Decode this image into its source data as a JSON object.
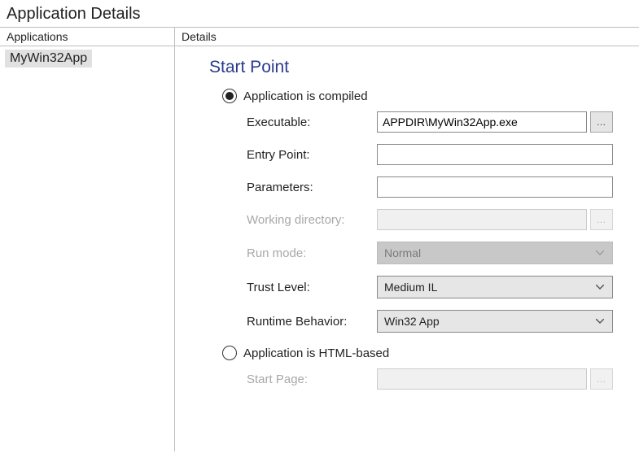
{
  "window": {
    "title": "Application Details"
  },
  "sidebar": {
    "header": "Applications",
    "items": [
      "MyWin32App"
    ]
  },
  "details": {
    "header": "Details",
    "section_title": "Start Point",
    "radio_compiled": "Application is compiled",
    "radio_html": "Application is HTML-based",
    "labels": {
      "executable": "Executable:",
      "entry_point": "Entry Point:",
      "parameters": "Parameters:",
      "working_dir": "Working directory:",
      "run_mode": "Run mode:",
      "trust_level": "Trust Level:",
      "runtime_behavior": "Runtime Behavior:",
      "start_page": "Start Page:"
    },
    "values": {
      "executable": "APPDIR\\MyWin32App.exe",
      "entry_point": "",
      "parameters": "",
      "working_dir": "",
      "run_mode": "Normal",
      "trust_level": "Medium IL",
      "runtime_behavior": "Win32 App",
      "start_page": ""
    }
  }
}
